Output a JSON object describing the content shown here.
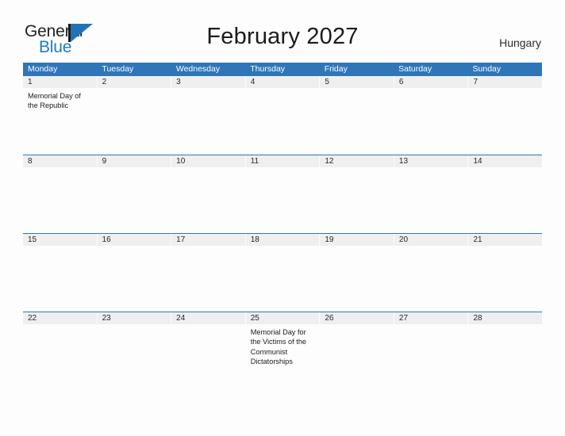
{
  "brand": {
    "word_one": "General",
    "word_two": "Blue",
    "mark_icon": "flag-triangle-icon",
    "accent_color": "#2273b5",
    "text_color": "#231f20",
    "blue_text_color": "#1d7cc4"
  },
  "header": {
    "title": "February 2027",
    "country": "Hungary"
  },
  "colors": {
    "header_blue": "#2e76b8",
    "day_band_gray": "#efefef",
    "page_background": "#fdfdfd",
    "text": "#1c1c1c"
  },
  "calendar": {
    "weekdays": [
      "Monday",
      "Tuesday",
      "Wednesday",
      "Thursday",
      "Friday",
      "Saturday",
      "Sunday"
    ],
    "weeks": [
      {
        "days": [
          {
            "num": "1",
            "event": "Memorial Day of the Republic"
          },
          {
            "num": "2",
            "event": ""
          },
          {
            "num": "3",
            "event": ""
          },
          {
            "num": "4",
            "event": ""
          },
          {
            "num": "5",
            "event": ""
          },
          {
            "num": "6",
            "event": ""
          },
          {
            "num": "7",
            "event": ""
          }
        ]
      },
      {
        "days": [
          {
            "num": "8",
            "event": ""
          },
          {
            "num": "9",
            "event": ""
          },
          {
            "num": "10",
            "event": ""
          },
          {
            "num": "11",
            "event": ""
          },
          {
            "num": "12",
            "event": ""
          },
          {
            "num": "13",
            "event": ""
          },
          {
            "num": "14",
            "event": ""
          }
        ]
      },
      {
        "days": [
          {
            "num": "15",
            "event": ""
          },
          {
            "num": "16",
            "event": ""
          },
          {
            "num": "17",
            "event": ""
          },
          {
            "num": "18",
            "event": ""
          },
          {
            "num": "19",
            "event": ""
          },
          {
            "num": "20",
            "event": ""
          },
          {
            "num": "21",
            "event": ""
          }
        ]
      },
      {
        "days": [
          {
            "num": "22",
            "event": ""
          },
          {
            "num": "23",
            "event": ""
          },
          {
            "num": "24",
            "event": ""
          },
          {
            "num": "25",
            "event": "Memorial Day for the Victims of the Communist Dictatorships"
          },
          {
            "num": "26",
            "event": ""
          },
          {
            "num": "27",
            "event": ""
          },
          {
            "num": "28",
            "event": ""
          }
        ]
      }
    ]
  }
}
